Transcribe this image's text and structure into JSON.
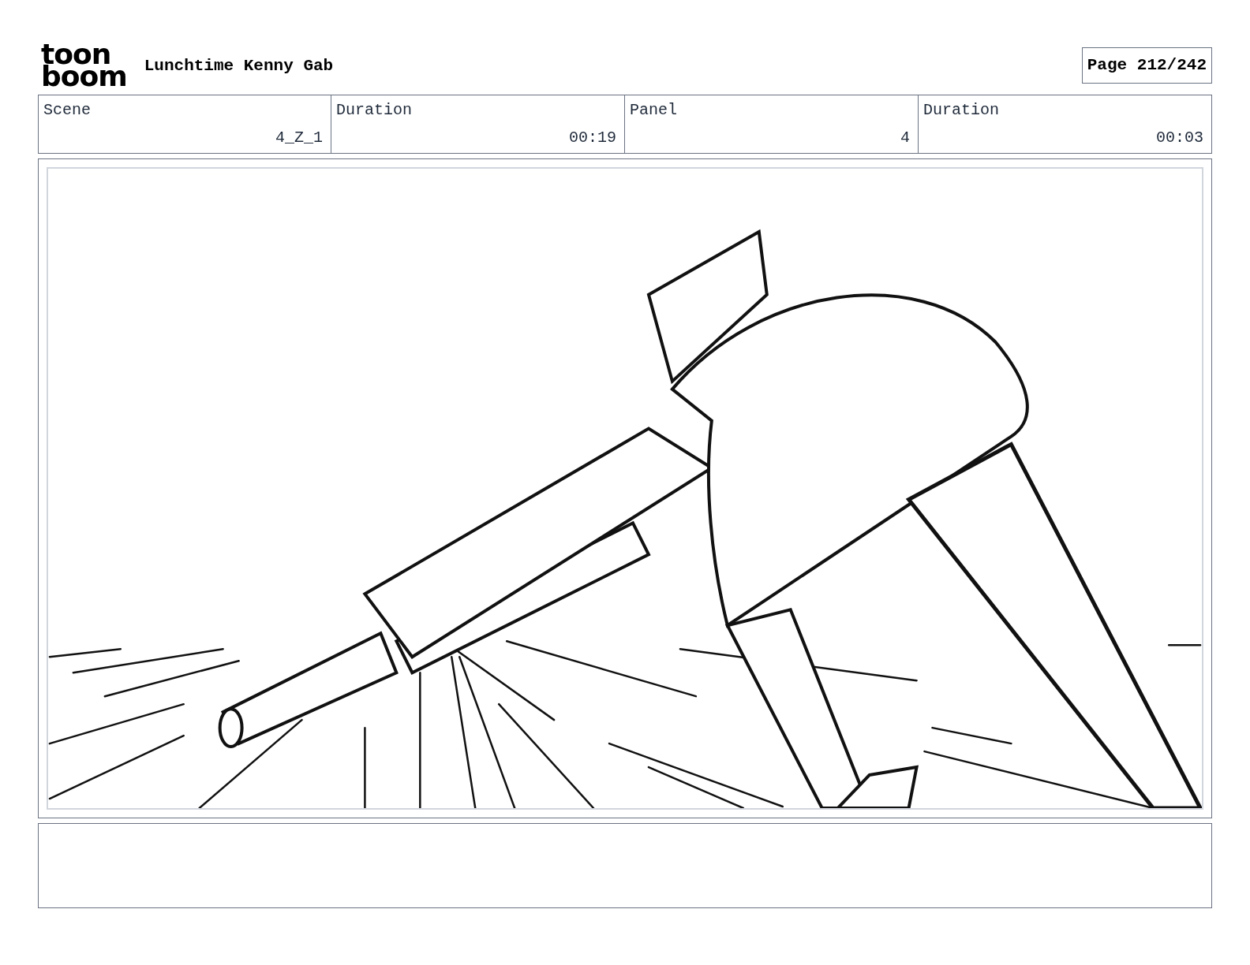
{
  "logo": {
    "line1": "toon",
    "line2": "boom"
  },
  "title": "Lunchtime Kenny Gab",
  "page": "Page 212/242",
  "info_table": {
    "labels": [
      "Scene",
      "Duration",
      "Panel",
      "Duration"
    ],
    "values": [
      "4_Z_1",
      "00:19",
      "4",
      "00:03"
    ]
  }
}
